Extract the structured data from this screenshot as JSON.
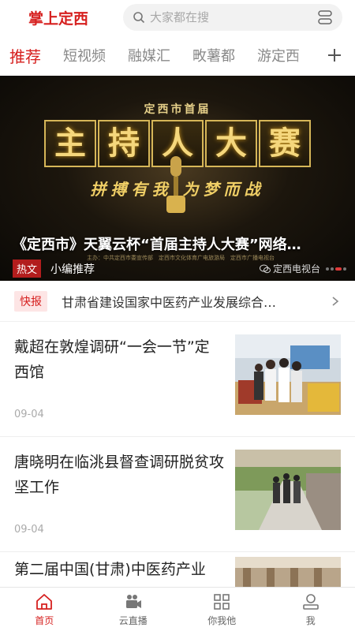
{
  "header": {
    "app_title": "掌上定西",
    "search_placeholder": "大家都在搜"
  },
  "tabs": [
    {
      "label": "推荐",
      "active": true
    },
    {
      "label": "短视频",
      "active": false
    },
    {
      "label": "融媒汇",
      "active": false
    },
    {
      "label": "畋薯都",
      "active": false
    },
    {
      "label": "游定西",
      "active": false
    }
  ],
  "banner": {
    "sub_title": "定西市首届",
    "main_chars": [
      "主",
      "持",
      "人",
      "大",
      "赛"
    ],
    "slogan": "拼搏有我 为梦而战",
    "sponsors": "主办：中共定西市委宣传部　定西市文化体育广电旅游局　定西市广播电视台",
    "caption": "《定西市》天翼云杯“首届主持人大赛”网络…",
    "tag": "热文",
    "editor": "小编推荐",
    "watermark": "定西电视台",
    "slide_count": 4,
    "active_slide": 2
  },
  "flash": {
    "tag": "快报",
    "text": "甘肃省建设国家中医药产业发展综合…"
  },
  "news": [
    {
      "title": "戴超在敦煌调研“一会一节”定西馆",
      "date": "09-04",
      "thumb_icon": "exhibition-photo"
    },
    {
      "title": "唐晓明在临洮县督查调研脱贫攻坚工作",
      "date": "09-04",
      "thumb_icon": "field-inspection-photo"
    },
    {
      "title": "第二届中国(甘肃)中医药产业",
      "date": "",
      "thumb_icon": "conference-photo"
    }
  ],
  "tabbar": [
    {
      "label": "首页",
      "icon": "home-icon",
      "active": true
    },
    {
      "label": "云直播",
      "icon": "video-camera-icon",
      "active": false
    },
    {
      "label": "你我他",
      "icon": "grid-icon",
      "active": false
    },
    {
      "label": "我",
      "icon": "user-icon",
      "active": false
    }
  ],
  "colors": {
    "accent": "#d6201f",
    "flash_bg": "#fde5e5"
  }
}
